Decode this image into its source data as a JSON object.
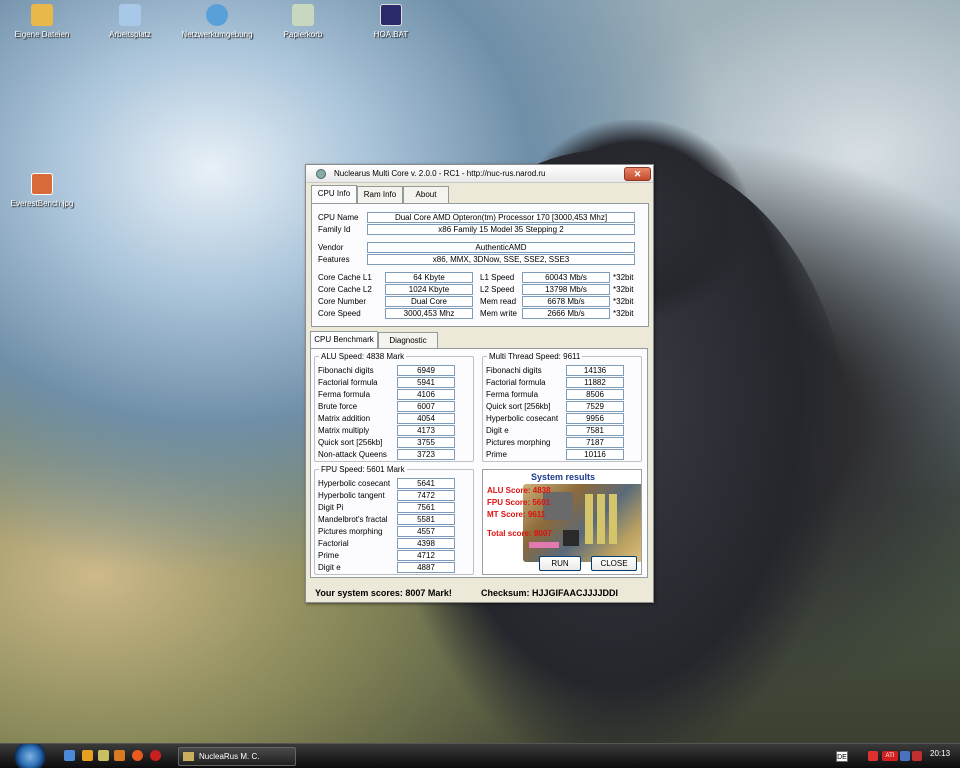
{
  "desktop": {
    "icons": [
      {
        "label": "Eigene Dateien",
        "icon": "documents-folder-icon",
        "color": "#e8b84a"
      },
      {
        "label": "Arbeitsplatz",
        "icon": "computer-icon",
        "color": "#a8c8e8"
      },
      {
        "label": "Netzwerkumgebung",
        "icon": "network-globe-icon",
        "color": "#5aa0d8"
      },
      {
        "label": "Papierkorb",
        "icon": "recycle-bin-icon",
        "color": "#c8d8c0"
      },
      {
        "label": "HOA.BAT",
        "icon": "batch-file-icon",
        "color": "#2a2a6a"
      },
      {
        "label": "EverestBench.jpg",
        "icon": "image-file-icon",
        "color": "#d86a3a"
      }
    ]
  },
  "window": {
    "title": "Nuclearus Multi Core  v. 2.0.0  -  RC1  -  http://nuc-rus.narod.ru",
    "close_glyph": "✕",
    "tabs": [
      "CPU Info",
      "Ram Info",
      "About"
    ],
    "cpu": {
      "cpu_name_label": "CPU Name",
      "cpu_name": "Dual Core AMD Opteron(tm) Processor 170   [3000,453 Mhz]",
      "family_label": "Family Id",
      "family": "x86 Family 15 Model 35 Stepping 2",
      "vendor_label": "Vendor",
      "vendor": "AuthenticAMD",
      "features_label": "Features",
      "features": "x86, MMX, 3DNow, SSE, SSE2, SSE3",
      "left_rows": [
        {
          "label": "Core Cache L1",
          "value": "64 Kbyte"
        },
        {
          "label": "Core Cache L2",
          "value": "1024 Kbyte"
        },
        {
          "label": "Core Number",
          "value": "Dual Core"
        },
        {
          "label": "Core Speed",
          "value": "3000,453 Mhz"
        }
      ],
      "right_rows": [
        {
          "label": "L1 Speed",
          "value": "60043 Mb/s",
          "unit": "*32bit"
        },
        {
          "label": "L2 Speed",
          "value": "13798 Mb/s",
          "unit": "*32bit"
        },
        {
          "label": "Mem read",
          "value": "6678 Mb/s",
          "unit": "*32bit"
        },
        {
          "label": "Mem write",
          "value": "2666 Mb/s",
          "unit": "*32bit"
        }
      ]
    },
    "bench_tabs": [
      "CPU Benchmark",
      "Diagnostic"
    ],
    "alu": {
      "title": "ALU Speed: 4838 Mark",
      "rows": [
        {
          "label": "Fibonachi digits",
          "value": "6949"
        },
        {
          "label": "Factorial formula",
          "value": "5941"
        },
        {
          "label": "Ferma formula",
          "value": "4106"
        },
        {
          "label": "Brute force",
          "value": "6007"
        },
        {
          "label": "Matrix addition",
          "value": "4054"
        },
        {
          "label": "Matrix multiply",
          "value": "4173"
        },
        {
          "label": "Quick sort [256kb]",
          "value": "3755"
        },
        {
          "label": "Non-attack Queens",
          "value": "3723"
        }
      ]
    },
    "mt": {
      "title": "Multi Thread Speed: 9611",
      "rows": [
        {
          "label": "Fibonachi digits",
          "value": "14136"
        },
        {
          "label": "Factorial formula",
          "value": "11882"
        },
        {
          "label": "Ferma formula",
          "value": "8506"
        },
        {
          "label": "Quick sort [256kb]",
          "value": "7529"
        },
        {
          "label": "Hyperbolic cosecant",
          "value": "9956"
        },
        {
          "label": "Digit e",
          "value": "7581"
        },
        {
          "label": "Pictures morphing",
          "value": "7187"
        },
        {
          "label": "Prime",
          "value": "10116"
        }
      ]
    },
    "fpu": {
      "title": "FPU Speed: 5601 Mark",
      "rows": [
        {
          "label": "Hyperbolic cosecant",
          "value": "5641"
        },
        {
          "label": "Hyperbolic tangent",
          "value": "7472"
        },
        {
          "label": "Digit Pi",
          "value": "7561"
        },
        {
          "label": "Mandelbrot's fractal",
          "value": "5581"
        },
        {
          "label": "Pictures morphing",
          "value": "4557"
        },
        {
          "label": "Factorial",
          "value": "4398"
        },
        {
          "label": "Prime",
          "value": "4712"
        },
        {
          "label": "Digit e",
          "value": "4887"
        }
      ]
    },
    "results": {
      "title": "System results",
      "lines": [
        "ALU Score: 4838",
        "FPU Score: 5601",
        "MT Score: 9611",
        "Total score: 8007"
      ],
      "run_label": "RUN",
      "close_label": "CLOSE"
    },
    "summary": {
      "score_text": "Your system scores: 8007 Mark!",
      "checksum_text": "Checksum:  HJJGIFAACJJJJDDI"
    }
  },
  "taskbar": {
    "task_label": "NucleaRus M. C.",
    "lang": "DE",
    "clock": "20:13",
    "tray_text": "ATI"
  }
}
